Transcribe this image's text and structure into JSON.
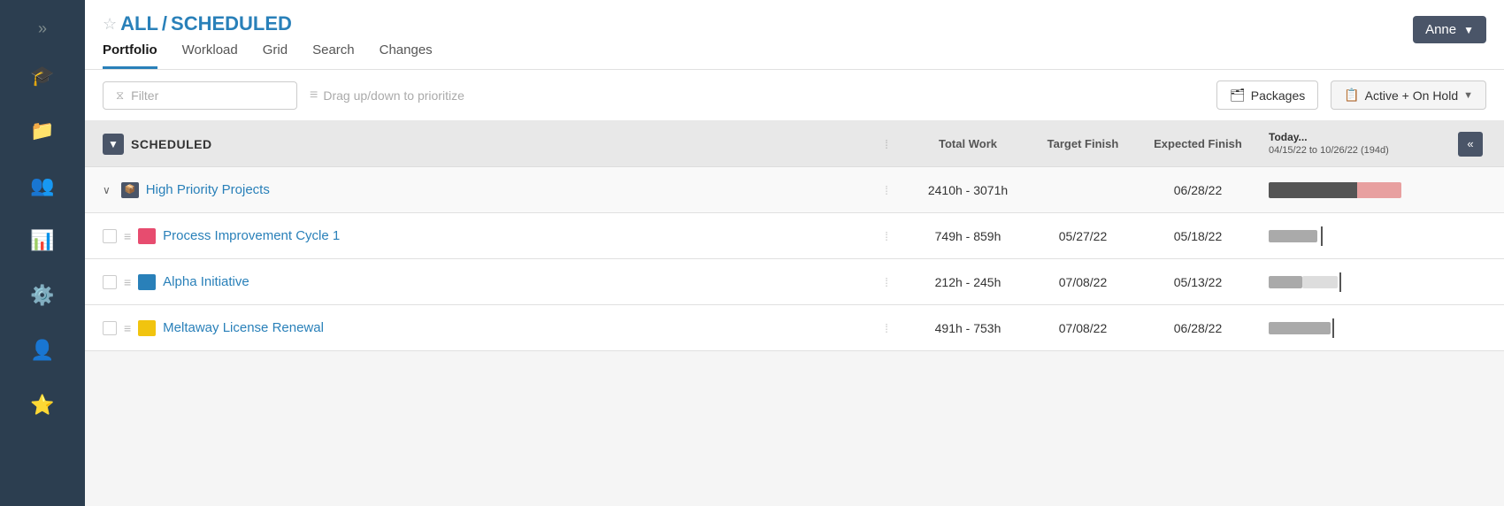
{
  "sidebar": {
    "collapse_icon": "»",
    "items": [
      {
        "id": "graduation",
        "icon": "🎓",
        "label": "Learning"
      },
      {
        "id": "folder",
        "icon": "📁",
        "label": "Files"
      },
      {
        "id": "people",
        "icon": "👥",
        "label": "People"
      },
      {
        "id": "chart",
        "icon": "📊",
        "label": "Reports"
      },
      {
        "id": "settings",
        "icon": "⚙️",
        "label": "Settings"
      },
      {
        "id": "user",
        "icon": "👤",
        "label": "Profile"
      },
      {
        "id": "star",
        "icon": "⭐",
        "label": "Favorites"
      }
    ]
  },
  "header": {
    "breadcrumb_star": "☆",
    "breadcrumb_all": "ALL",
    "breadcrumb_sep": "/",
    "breadcrumb_scheduled": "SCHEDULED",
    "user_label": "Anne",
    "user_arrow": "▼"
  },
  "tabs": [
    {
      "id": "portfolio",
      "label": "Portfolio",
      "active": true
    },
    {
      "id": "workload",
      "label": "Workload",
      "active": false
    },
    {
      "id": "grid",
      "label": "Grid",
      "active": false
    },
    {
      "id": "search",
      "label": "Search",
      "active": false
    },
    {
      "id": "changes",
      "label": "Changes",
      "active": false
    }
  ],
  "toolbar": {
    "filter_placeholder": "Filter",
    "drag_hint": "Drag up/down to prioritize",
    "packages_label": "Packages",
    "active_hold_label": "Active + On Hold",
    "active_hold_dropdown": "▼",
    "filter_icon": "⧖",
    "drag_icon": "≡"
  },
  "table": {
    "columns": {
      "name_label": "SCHEDULED",
      "total_work_label": "Total Work",
      "target_finish_label": "Target Finish",
      "expected_finish_label": "Expected Finish",
      "today_label": "Today...",
      "today_range": "04/15/22 to 10/26/22 (194d)",
      "collapse_icon": "«"
    },
    "rows": [
      {
        "type": "group",
        "name": "High Priority Projects",
        "total_work": "2410h - 3071h",
        "target_finish": "",
        "expected_finish": "06/28/22",
        "gantt_type": "group"
      },
      {
        "type": "project",
        "name": "Process Improvement Cycle 1",
        "icon_color": "pink",
        "total_work": "749h - 859h",
        "target_finish": "05/27/22",
        "expected_finish": "05/18/22",
        "gantt_type": "short_past"
      },
      {
        "type": "project",
        "name": "Alpha Initiative",
        "icon_color": "blue",
        "total_work": "212h - 245h",
        "target_finish": "07/08/22",
        "expected_finish": "05/13/22",
        "gantt_type": "medium_past"
      },
      {
        "type": "project",
        "name": "Meltaway License Renewal",
        "icon_color": "yellow",
        "total_work": "491h - 753h",
        "target_finish": "07/08/22",
        "expected_finish": "06/28/22",
        "gantt_type": "long_past"
      }
    ]
  }
}
